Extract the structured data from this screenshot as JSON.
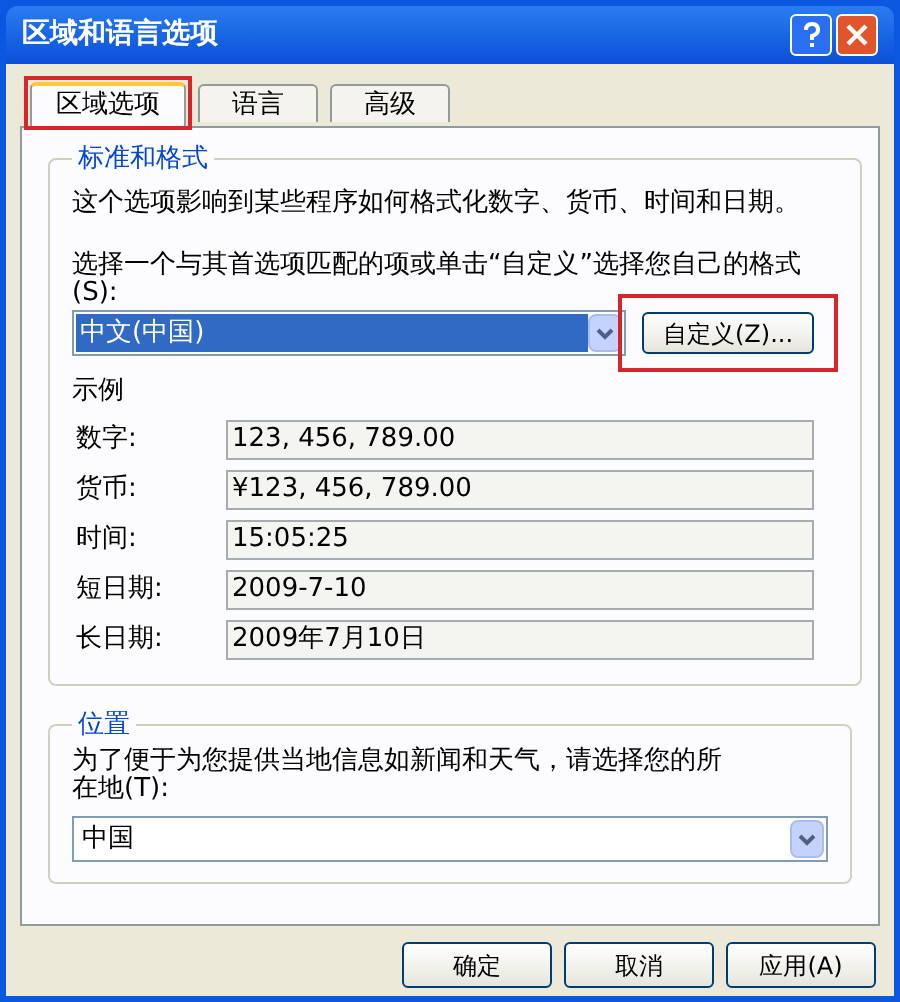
{
  "window": {
    "title": "区域和语言选项"
  },
  "tabs": [
    {
      "label": "区域选项",
      "selected": true,
      "highlighted": true
    },
    {
      "label": "语言",
      "selected": false,
      "highlighted": false
    },
    {
      "label": "高级",
      "selected": false,
      "highlighted": false
    }
  ],
  "standards": {
    "title": "标准和格式",
    "description": "这个选项影响到某些程序如何格式化数字、货币、时间和日期。",
    "prompt": "选择一个与其首选项匹配的项或单击“自定义”选择您自己的格式(S):",
    "format_value": "中文(中国)",
    "customize_button": {
      "label": "自定义(Z)...",
      "highlighted": true
    },
    "samples_title": "示例",
    "samples": [
      {
        "label": "数字:",
        "value": "123, 456, 789.00"
      },
      {
        "label": "货币:",
        "value": "¥123, 456, 789.00"
      },
      {
        "label": "时间:",
        "value": "15:05:25"
      },
      {
        "label": "短日期:",
        "value": "2009-7-10"
      },
      {
        "label": "长日期:",
        "value": "2009年7月10日"
      }
    ]
  },
  "location": {
    "title": "位置",
    "prompt": "为了便于为您提供当地信息如新闻和天气，请选择您的所在地(T):",
    "value": "中国"
  },
  "buttons": [
    "确定",
    "取消",
    "应用(A)"
  ]
}
